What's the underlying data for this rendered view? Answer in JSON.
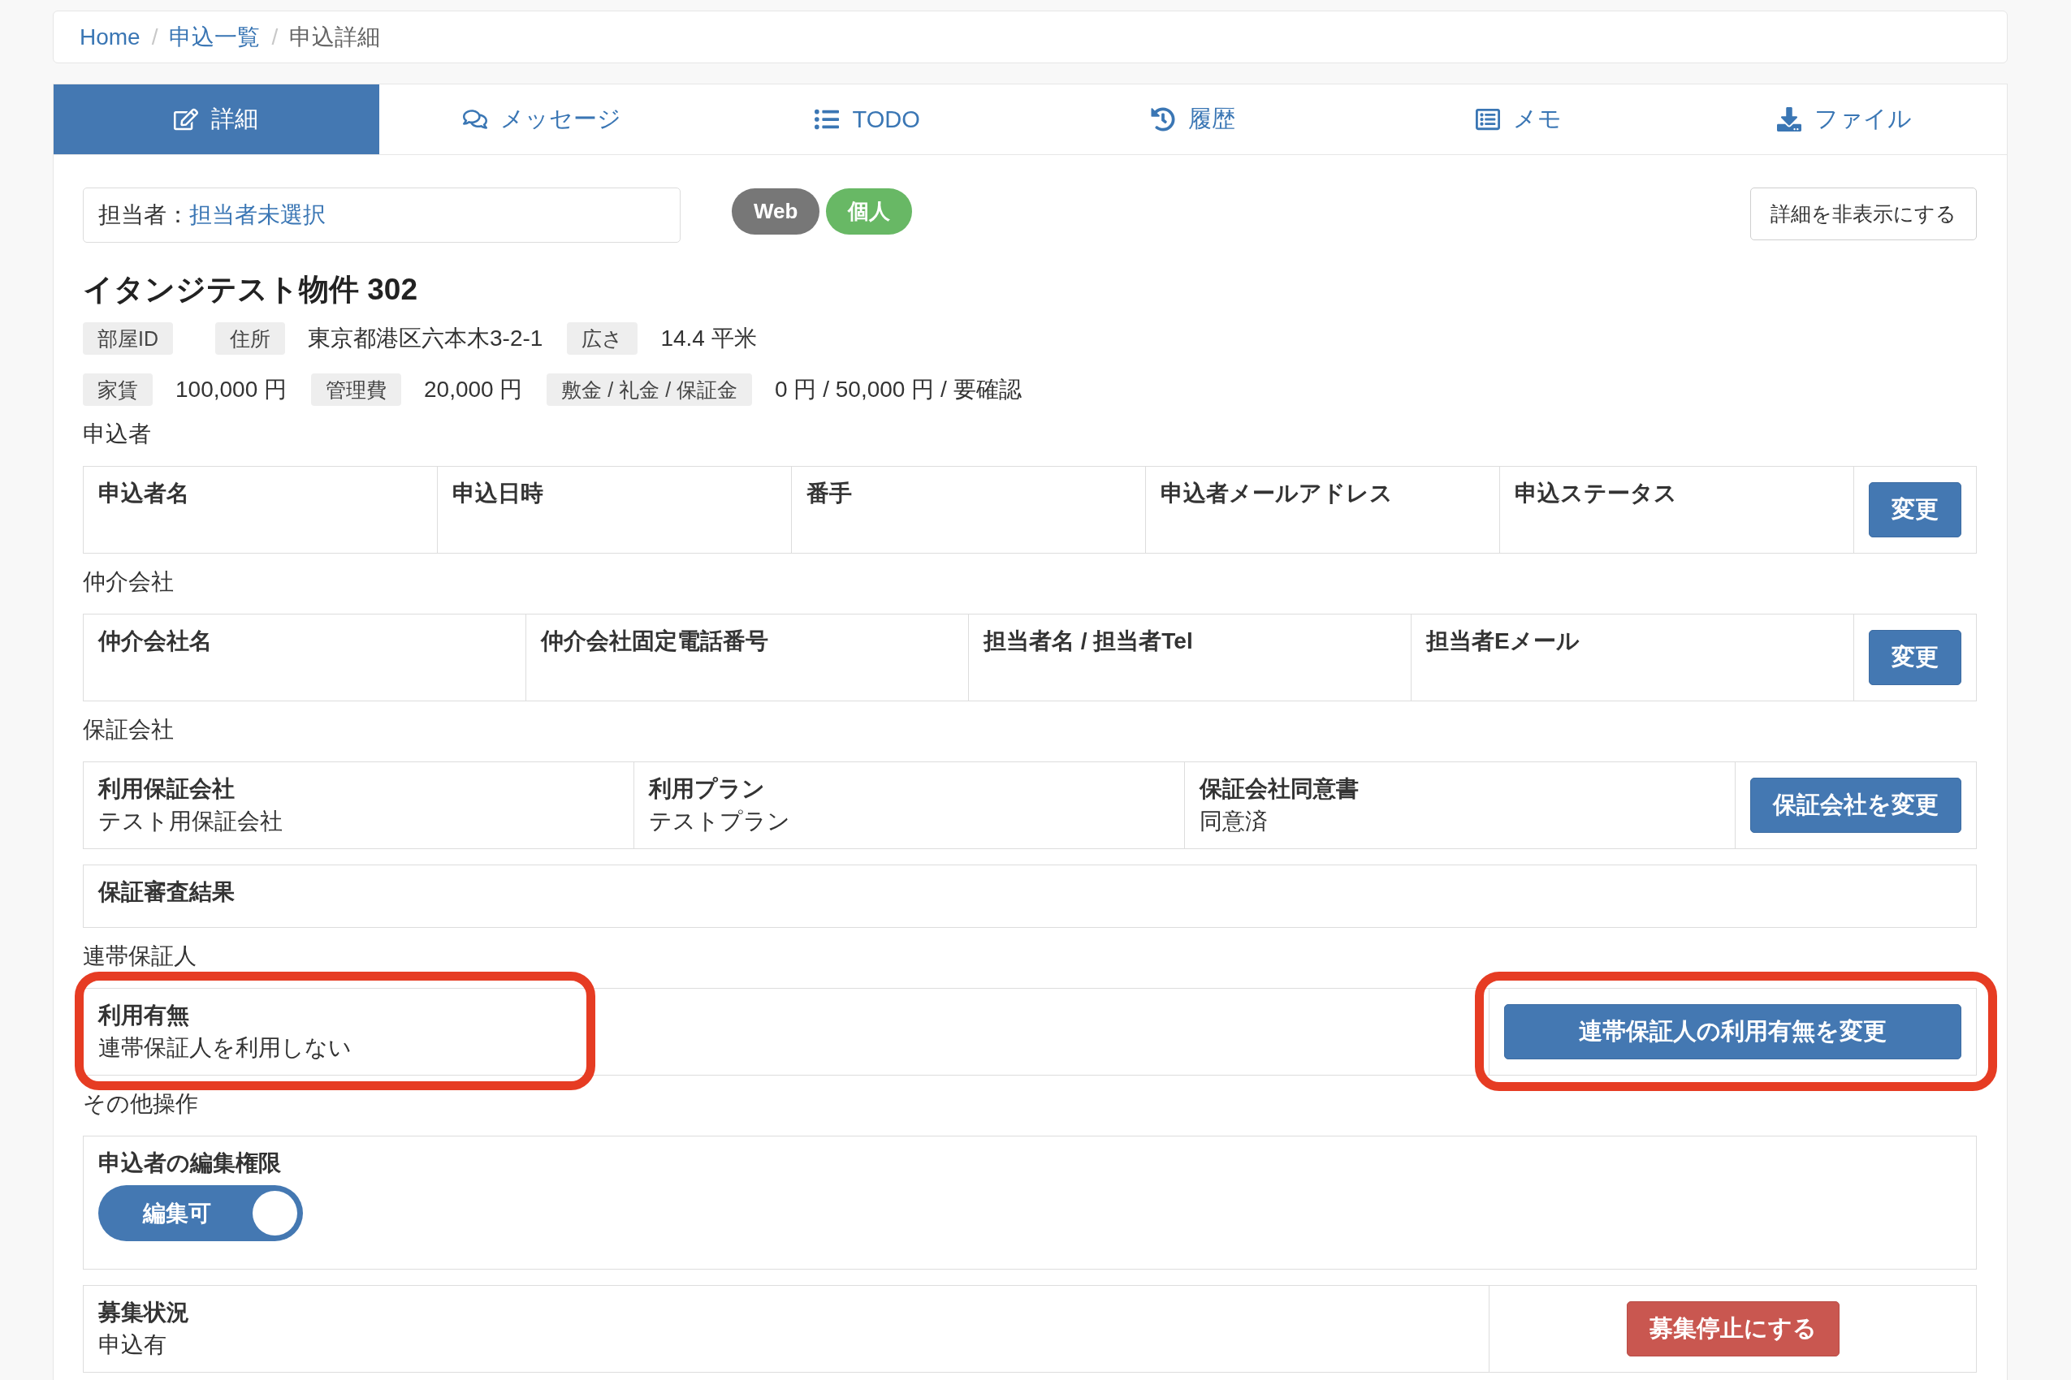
{
  "breadcrumb": [
    {
      "label": "Home",
      "current": false
    },
    {
      "separator": "/",
      "label": "申込一覧",
      "current": false
    },
    {
      "separator": "/",
      "label": "申込詳細",
      "current": true
    }
  ],
  "tabs": [
    {
      "label": "詳細",
      "selected": true
    },
    {
      "label": "メッセージ",
      "selected": false
    },
    {
      "label": "TODO",
      "selected": false
    },
    {
      "label": "履歴",
      "selected": false
    },
    {
      "label": "メモ",
      "selected": false
    },
    {
      "label": "ファイル",
      "selected": false
    }
  ],
  "assignee": {
    "label": "担当者：",
    "value": "担当者未選択"
  },
  "badges": [
    {
      "label": "Web",
      "color": "#777777"
    },
    {
      "label": "個人",
      "color": "#68b865"
    }
  ],
  "hide_details_button": "詳細を非表示にする",
  "property": {
    "title": "イタンジテスト物件 302",
    "rows": [
      [
        {
          "label": "部屋ID"
        },
        {
          "label": "住所",
          "value": "東京都港区六本木3-2-1"
        },
        {
          "label": "広さ",
          "value": "14.4 平米"
        }
      ],
      [
        {
          "label": "家賃",
          "value": "100,000 円"
        },
        {
          "label": "管理費",
          "value": "20,000 円"
        },
        {
          "label": "敷金 / 礼金 / 保証金",
          "value": "0 円 / 50,000 円 / 要確認"
        }
      ]
    ]
  },
  "sections": [
    {
      "title": "申込者",
      "panels": [
        {
          "kind": "columns",
          "fields": [
            {
              "kind": "text",
              "label": "申込者名"
            },
            {
              "kind": "text",
              "label": "申込日時"
            },
            {
              "kind": "text",
              "label": "番手"
            },
            {
              "kind": "text",
              "label": "申込者メールアドレス"
            },
            {
              "kind": "text",
              "label": "申込ステータス"
            }
          ],
          "action": {
            "label": "変更",
            "kind": "primary"
          }
        }
      ]
    },
    {
      "title": "仲介会社",
      "panels": [
        {
          "kind": "columns",
          "fields": [
            {
              "kind": "text",
              "label": "仲介会社名"
            },
            {
              "kind": "text",
              "label": "仲介会社固定電話番号"
            },
            {
              "kind": "text",
              "label": "担当者名 / 担当者Tel"
            },
            {
              "kind": "text",
              "label": "担当者Eメール"
            }
          ],
          "action": {
            "label": "変更",
            "kind": "primary"
          }
        }
      ]
    },
    {
      "title": "保証会社",
      "panels": [
        {
          "kind": "columns",
          "fields": [
            {
              "kind": "text",
              "label": "利用保証会社",
              "value": "テスト用保証会社"
            },
            {
              "kind": "text",
              "label": "利用プラン",
              "value": "テストプラン"
            },
            {
              "kind": "text",
              "label": "保証会社同意書",
              "value": "同意済"
            }
          ],
          "action": {
            "label": "保証会社を変更",
            "kind": "primary"
          }
        },
        {
          "kind": "columns",
          "fields": [
            {
              "kind": "text",
              "label": "保証審査結果"
            }
          ]
        }
      ]
    },
    {
      "title": "連帯保証人",
      "panels": [
        {
          "kind": "split",
          "fields": [
            {
              "kind": "text",
              "label": "利用有無",
              "value": "連帯保証人を利用しない",
              "highlighted": true
            }
          ],
          "action": {
            "label": "連帯保証人の利用有無を変更",
            "kind": "primary",
            "block": true,
            "highlighted": true
          }
        }
      ]
    },
    {
      "title": "その他操作",
      "panels": [
        {
          "kind": "columns",
          "fields": [
            {
              "kind": "toggle",
              "label": "申込者の編集権限",
              "toggle": {
                "label": "編集可",
                "on": true
              }
            }
          ]
        },
        {
          "kind": "split",
          "fields": [
            {
              "kind": "text",
              "label": "募集状況",
              "value": "申込有"
            }
          ],
          "action": {
            "label": "募集停止にする",
            "kind": "danger",
            "block": false
          }
        }
      ]
    }
  ]
}
